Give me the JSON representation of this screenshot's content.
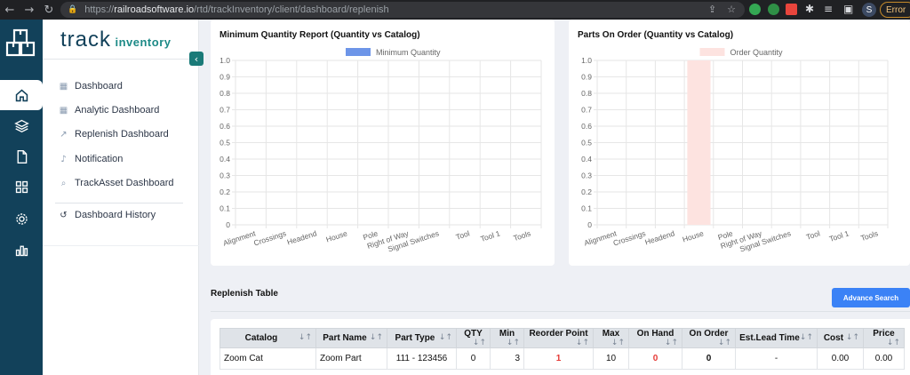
{
  "browser": {
    "url_scheme": "https://",
    "url_host": "railroadsoftware.io",
    "url_path": "/rtd/trackInventory/client/dashboard/replenish",
    "profile_initial": "S",
    "error_label": "Error"
  },
  "brand": {
    "word1": "track",
    "word2": "inventory"
  },
  "sidemenu": {
    "items": [
      {
        "label": "Dashboard"
      },
      {
        "label": "Analytic Dashboard"
      },
      {
        "label": "Replenish Dashboard"
      },
      {
        "label": "Notification"
      },
      {
        "label": "TrackAsset Dashboard"
      }
    ],
    "history_label": "Dashboard History"
  },
  "charts": {
    "min_title": "Minimum Quantity Report (Quantity vs Catalog)",
    "order_title": "Parts On Order (Quantity vs Catalog)"
  },
  "chart_data": [
    {
      "type": "bar",
      "title": "Minimum Quantity Report (Quantity vs Catalog)",
      "categories": [
        "Alignment",
        "Crossings",
        "Headend",
        "House",
        "Pole",
        "Right of Way",
        "Signal Switches",
        "Tool",
        "Tool 1",
        "Tools"
      ],
      "series": [
        {
          "name": "Minimum Quantity",
          "values": [
            0,
            0,
            0,
            0,
            0,
            0,
            0,
            0,
            0,
            0
          ],
          "color": "#6d95e8"
        }
      ],
      "ylim": [
        0,
        1.0
      ],
      "yticks": [
        "1.0",
        "0.9",
        "0.8",
        "0.7",
        "0.6",
        "0.5",
        "0.4",
        "0.3",
        "0.2",
        "0.1",
        "0"
      ],
      "legend": "top-center",
      "grid": true
    },
    {
      "type": "bar",
      "title": "Parts On Order (Quantity vs Catalog)",
      "categories": [
        "Alignment",
        "Crossings",
        "Headend",
        "House",
        "Pole",
        "Right of Way",
        "Signal Switches",
        "Tool",
        "Tool 1",
        "Tools"
      ],
      "series": [
        {
          "name": "Order Quantity",
          "values": [
            0,
            0,
            0,
            1.0,
            0,
            0,
            0,
            0,
            0,
            0
          ],
          "color": "#fde3e0"
        }
      ],
      "ylim": [
        0,
        1.0
      ],
      "yticks": [
        "1.0",
        "0.9",
        "0.8",
        "0.7",
        "0.6",
        "0.5",
        "0.4",
        "0.3",
        "0.2",
        "0.1",
        "0"
      ],
      "legend": "top-center",
      "grid": true
    }
  ],
  "replenish": {
    "title": "Replenish Table",
    "advance_search": "Advance Search",
    "columns": [
      "Catalog",
      "Part Name",
      "Part Type",
      "QTY",
      "Min",
      "Reorder Point",
      "Max",
      "On Hand",
      "On Order",
      "Est.Lead Time",
      "Cost",
      "Price"
    ],
    "rows": [
      {
        "catalog": "Zoom Cat",
        "part_name": "Zoom Part",
        "part_type": "111 - 123456",
        "qty": "0",
        "min": "3",
        "reorder_point": "1",
        "max": "10",
        "on_hand": "0",
        "on_order": "0",
        "lead_time": "-",
        "cost": "0.00",
        "price": "0.00"
      }
    ]
  }
}
